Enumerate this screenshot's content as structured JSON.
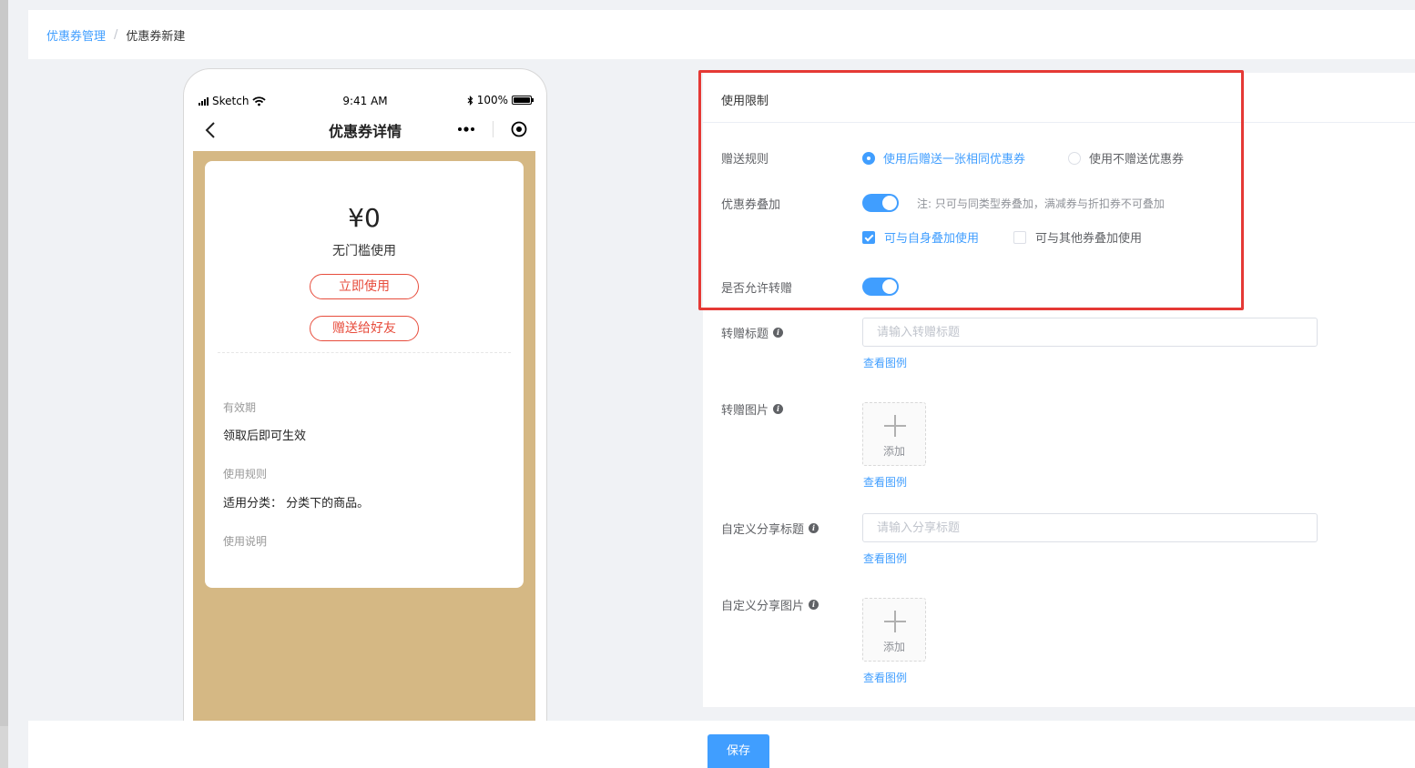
{
  "breadcrumb": {
    "parent": "优惠券管理",
    "separator": "/",
    "current": "优惠券新建"
  },
  "phone": {
    "carrier": "Sketch",
    "time": "9:41 AM",
    "battery": "100%",
    "battery_level": 1.0,
    "nav_title": "优惠券详情",
    "coupon": {
      "price": "¥0",
      "threshold": "无门槛使用",
      "use_now": "立即使用",
      "gift_friend": "赠送给好友",
      "validity_label": "有效期",
      "validity_value": "领取后即可生效",
      "rules_label": "使用规则",
      "rules_value": "适用分类： 分类下的商品。",
      "instructions_label": "使用说明"
    }
  },
  "form": {
    "section_title": "使用限制",
    "gift_rule": {
      "label": "赠送规则",
      "options": [
        "使用后赠送一张相同优惠券",
        "使用不赠送优惠券"
      ],
      "selected": "使用后赠送一张相同优惠券"
    },
    "stacking": {
      "label": "优惠券叠加",
      "enabled": true,
      "note": "注: 只可与同类型券叠加，满减券与折扣券不可叠加",
      "options": [
        {
          "label": "可与自身叠加使用",
          "checked": true
        },
        {
          "label": "可与其他券叠加使用",
          "checked": false
        }
      ]
    },
    "allow_transfer": {
      "label": "是否允许转赠",
      "enabled": true
    },
    "transfer_title": {
      "label": "转赠标题",
      "placeholder": "请输入转赠标题",
      "value": "",
      "example": "查看图例"
    },
    "transfer_image": {
      "label": "转赠图片",
      "upload_text": "添加",
      "example": "查看图例"
    },
    "share_title": {
      "label": "自定义分享标题",
      "placeholder": "请输入分享标题",
      "value": "",
      "example": "查看图例"
    },
    "share_image": {
      "label": "自定义分享图片",
      "upload_text": "添加",
      "example": "查看图例"
    }
  },
  "footer": {
    "save_label": "保存"
  },
  "colors": {
    "primary": "#409eff",
    "highlight": "#e53935",
    "coupon_bg": "#d5b884",
    "coupon_accent": "#e74c3c"
  }
}
